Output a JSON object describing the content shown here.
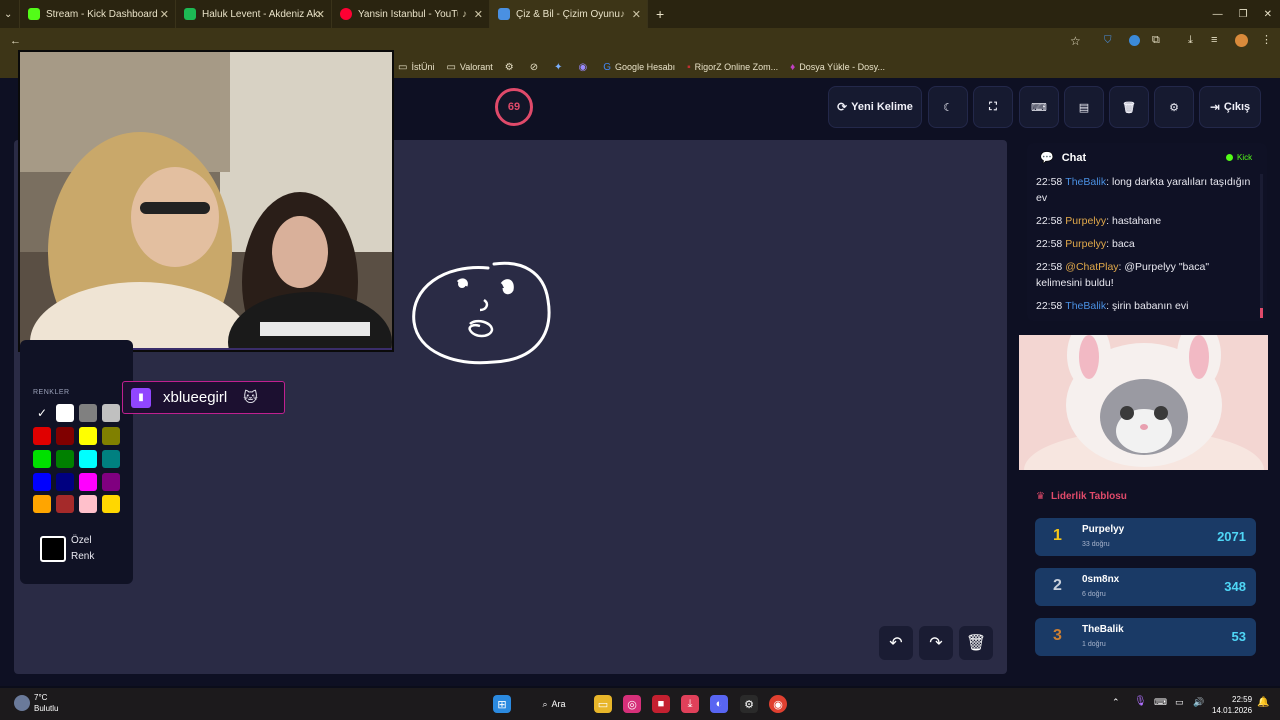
{
  "browser": {
    "tabs": [
      {
        "label": "Stream - Kick Dashboard",
        "color": "#53fc18"
      },
      {
        "label": "Haluk Levent - Akdeniz Akşamla",
        "color": "#1db954"
      },
      {
        "label": "Yansin Istanbul - YouTube",
        "color": "#ff0033"
      },
      {
        "label": "Çiz & Bil - Çizim Oyunu",
        "color": "#4a90e2"
      }
    ],
    "bookmarks": [
      "İstÜni",
      "Valorant",
      "Google Hesabı",
      "RigorZ Online Zom...",
      "Dosya Yükle - Dosy..."
    ]
  },
  "game": {
    "timer": "69",
    "toolbar": {
      "new_word": "Yeni Kelime",
      "exit": "Çıkış"
    },
    "palette_title": "RENKLER",
    "custom_color": [
      "Özel",
      "Renk"
    ],
    "colors": [
      "#000000",
      "#ffffff",
      "#808080",
      "#c0c0c0",
      "#e00000",
      "#800000",
      "#ffff00",
      "#808000",
      "#00e000",
      "#008000",
      "#00ffff",
      "#008080",
      "#0000ff",
      "#000080",
      "#ff00ff",
      "#800080",
      "#ffa500",
      "#a52a2a",
      "#ffc0cb",
      "#ffd700"
    ]
  },
  "twitch": {
    "name": "xblueegirl"
  },
  "chat": {
    "title": "Chat",
    "source": "Kick",
    "messages": [
      {
        "time": "22:58",
        "user": "TheBalik",
        "text": "long darkta yaralıları taşıdığın ev",
        "color": "blue"
      },
      {
        "time": "22:58",
        "user": "Purpelyy",
        "text": "hastahane",
        "color": "gold"
      },
      {
        "time": "22:58",
        "user": "Purpelyy",
        "text": "baca",
        "color": "gold"
      },
      {
        "time": "22:58",
        "user": "@ChatPlay",
        "text": "@Purpelyy \"baca\" kelimesini buldu!",
        "color": "gold"
      },
      {
        "time": "22:58",
        "user": "TheBalik",
        "text": "şirin babanın evi",
        "color": "blue"
      }
    ]
  },
  "leaderboard": {
    "title": "Liderlik Tablosu",
    "rows": [
      {
        "rank": "1",
        "name": "Purpelyy",
        "sub": "33 doğru",
        "score": "2071",
        "rank_color": "#f5c518"
      },
      {
        "rank": "2",
        "name": "0sm8nx",
        "sub": "6 doğru",
        "score": "348",
        "rank_color": "#c8d0dc"
      },
      {
        "rank": "3",
        "name": "TheBalik",
        "sub": "1 doğru",
        "score": "53",
        "rank_color": "#cd7f32"
      }
    ]
  },
  "taskbar": {
    "temp": "7°C",
    "weather": "Bulutlu",
    "search": "Ara",
    "time": "22:59",
    "date": "14.01.2026"
  }
}
